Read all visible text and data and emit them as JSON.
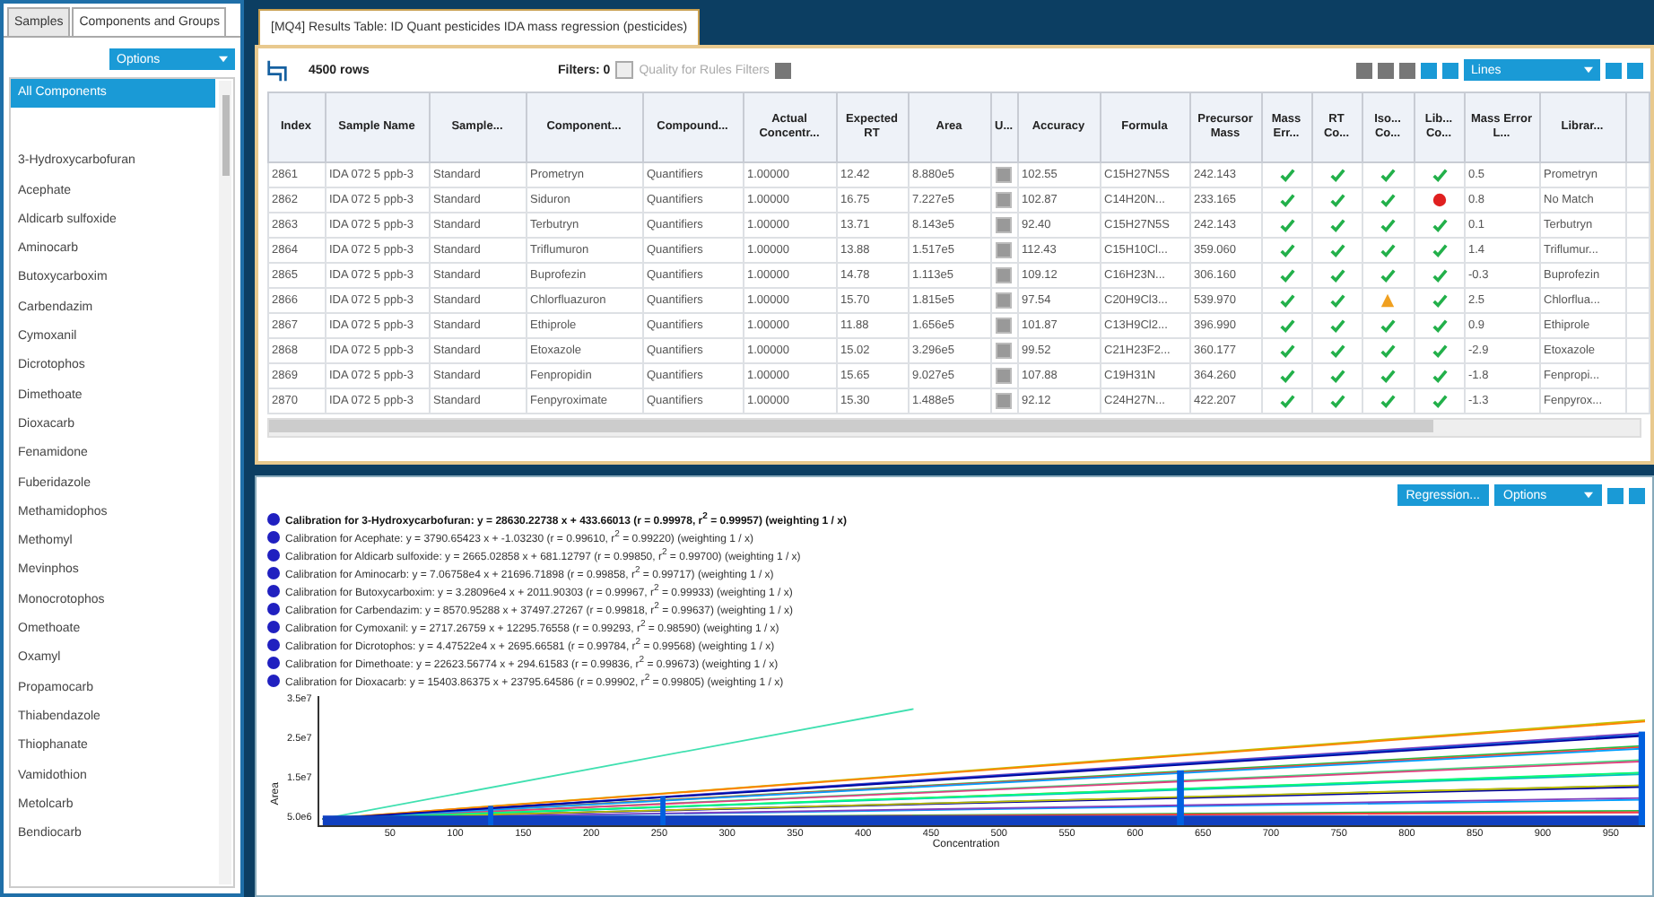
{
  "left_panel": {
    "tabs": [
      {
        "label": "Samples",
        "selected": false
      },
      {
        "label": "Components and Groups",
        "selected": true
      }
    ],
    "options_dropdown": "Options",
    "items": [
      {
        "label": "All Components",
        "selected": true
      },
      {
        "label": "3-Hydroxycarbofuran",
        "selected": false
      },
      {
        "label": "Acephate",
        "selected": false
      },
      {
        "label": "Aldicarb sulfoxide",
        "selected": false
      },
      {
        "label": "Aminocarb",
        "selected": false
      },
      {
        "label": "Butoxycarboxim",
        "selected": false
      },
      {
        "label": "Carbendazim",
        "selected": false
      },
      {
        "label": "Cymoxanil",
        "selected": false
      },
      {
        "label": "Dicrotophos",
        "selected": false
      },
      {
        "label": "Dimethoate",
        "selected": false
      },
      {
        "label": "Dioxacarb",
        "selected": false
      },
      {
        "label": "Fenamidone",
        "selected": false
      },
      {
        "label": "Fuberidazole",
        "selected": false
      },
      {
        "label": "Methamidophos",
        "selected": false
      },
      {
        "label": "Methomyl",
        "selected": false
      },
      {
        "label": "Mevinphos",
        "selected": false
      },
      {
        "label": "Monocrotophos",
        "selected": false
      },
      {
        "label": "Omethoate",
        "selected": false
      },
      {
        "label": "Oxamyl",
        "selected": false
      },
      {
        "label": "Propamocarb",
        "selected": false
      },
      {
        "label": "Thiabendazole",
        "selected": false
      },
      {
        "label": "Thiophanate",
        "selected": false
      },
      {
        "label": "Vamidothion",
        "selected": false
      },
      {
        "label": "Metolcarb",
        "selected": false
      },
      {
        "label": "Bendiocarb",
        "selected": false
      }
    ]
  },
  "document_tab": "[MQ4] Results Table: ID Quant pesticides IDA mass regression (pesticides)",
  "toolbar": {
    "row_count": "4500 rows",
    "filters": "Filters: 0",
    "quality_filter": {
      "label": "Quality for Rules Filters",
      "checked": false
    },
    "view_dropdown": "Lines"
  },
  "table": {
    "columns": [
      "Index",
      "Sample Name",
      "Sample...",
      "Component...",
      "Compound...",
      "Actual Concentr...",
      "Expected RT",
      "Area",
      "U...",
      "Accuracy",
      "Formula",
      "Precursor Mass",
      "Mass Err...",
      "RT Co...",
      "Iso... Co...",
      "Lib... Co...",
      "Mass Error L...",
      "Librar..."
    ],
    "rows": [
      {
        "cells": [
          "2861",
          "IDA 072 5 ppb-3",
          "Standard",
          "Prometryn",
          "Quantifiers",
          "1.00000",
          "12.42",
          "8.880e5",
          "",
          "102.55",
          "C15H27N5S",
          "242.143",
          "",
          "",
          "",
          "",
          "0.5",
          "Prometryn"
        ],
        "used": true,
        "checks": [
          {
            "passed": true,
            "warning": false
          },
          {
            "passed": true,
            "warning": false
          },
          {
            "passed": true,
            "warning": false
          },
          {
            "passed": true,
            "warning": false
          }
        ]
      },
      {
        "cells": [
          "2862",
          "IDA 072 5 ppb-3",
          "Standard",
          "Siduron",
          "Quantifiers",
          "1.00000",
          "16.75",
          "7.227e5",
          "",
          "102.87",
          "C14H20N...",
          "233.165",
          "",
          "",
          "",
          "",
          "0.8",
          "No Match"
        ],
        "used": true,
        "checks": [
          {
            "passed": true,
            "warning": false
          },
          {
            "passed": true,
            "warning": false
          },
          {
            "passed": true,
            "warning": false
          },
          {
            "passed": false,
            "warning": false
          }
        ]
      },
      {
        "cells": [
          "2863",
          "IDA 072 5 ppb-3",
          "Standard",
          "Terbutryn",
          "Quantifiers",
          "1.00000",
          "13.71",
          "8.143e5",
          "",
          "92.40",
          "C15H27N5S",
          "242.143",
          "",
          "",
          "",
          "",
          "0.1",
          "Terbutryn"
        ],
        "used": true,
        "checks": [
          {
            "passed": true,
            "warning": false
          },
          {
            "passed": true,
            "warning": false
          },
          {
            "passed": true,
            "warning": false
          },
          {
            "passed": true,
            "warning": false
          }
        ]
      },
      {
        "cells": [
          "2864",
          "IDA 072 5 ppb-3",
          "Standard",
          "Triflumuron",
          "Quantifiers",
          "1.00000",
          "13.88",
          "1.517e5",
          "",
          "112.43",
          "C15H10Cl...",
          "359.060",
          "",
          "",
          "",
          "",
          "1.4",
          "Triflumur..."
        ],
        "used": true,
        "checks": [
          {
            "passed": true,
            "warning": false
          },
          {
            "passed": true,
            "warning": false
          },
          {
            "passed": true,
            "warning": false
          },
          {
            "passed": true,
            "warning": false
          }
        ]
      },
      {
        "cells": [
          "2865",
          "IDA 072 5 ppb-3",
          "Standard",
          "Buprofezin",
          "Quantifiers",
          "1.00000",
          "14.78",
          "1.113e5",
          "",
          "109.12",
          "C16H23N...",
          "306.160",
          "",
          "",
          "",
          "",
          "-0.3",
          "Buprofezin"
        ],
        "used": true,
        "checks": [
          {
            "passed": true,
            "warning": false
          },
          {
            "passed": true,
            "warning": false
          },
          {
            "passed": true,
            "warning": false
          },
          {
            "passed": true,
            "warning": false
          }
        ]
      },
      {
        "cells": [
          "2866",
          "IDA 072 5 ppb-3",
          "Standard",
          "Chlorfluazuron",
          "Quantifiers",
          "1.00000",
          "15.70",
          "1.815e5",
          "",
          "97.54",
          "C20H9Cl3...",
          "539.970",
          "",
          "",
          "",
          "",
          "2.5",
          "Chlorflua..."
        ],
        "used": true,
        "checks": [
          {
            "passed": true,
            "warning": false
          },
          {
            "passed": true,
            "warning": false
          },
          {
            "passed": false,
            "warning": true
          },
          {
            "passed": true,
            "warning": false
          }
        ]
      },
      {
        "cells": [
          "2867",
          "IDA 072 5 ppb-3",
          "Standard",
          "Ethiprole",
          "Quantifiers",
          "1.00000",
          "11.88",
          "1.656e5",
          "",
          "101.87",
          "C13H9Cl2...",
          "396.990",
          "",
          "",
          "",
          "",
          "0.9",
          "Ethiprole"
        ],
        "used": true,
        "checks": [
          {
            "passed": true,
            "warning": false
          },
          {
            "passed": true,
            "warning": false
          },
          {
            "passed": true,
            "warning": false
          },
          {
            "passed": true,
            "warning": false
          }
        ]
      },
      {
        "cells": [
          "2868",
          "IDA 072 5 ppb-3",
          "Standard",
          "Etoxazole",
          "Quantifiers",
          "1.00000",
          "15.02",
          "3.296e5",
          "",
          "99.52",
          "C21H23F2...",
          "360.177",
          "",
          "",
          "",
          "",
          "-2.9",
          "Etoxazole"
        ],
        "used": true,
        "checks": [
          {
            "passed": true,
            "warning": false
          },
          {
            "passed": true,
            "warning": false
          },
          {
            "passed": true,
            "warning": false
          },
          {
            "passed": true,
            "warning": false
          }
        ]
      },
      {
        "cells": [
          "2869",
          "IDA 072 5 ppb-3",
          "Standard",
          "Fenpropidin",
          "Quantifiers",
          "1.00000",
          "15.65",
          "9.027e5",
          "",
          "107.88",
          "C19H31N",
          "364.260",
          "",
          "",
          "",
          "",
          "-1.8",
          "Fenpropi..."
        ],
        "used": true,
        "checks": [
          {
            "passed": true,
            "warning": false
          },
          {
            "passed": true,
            "warning": false
          },
          {
            "passed": true,
            "warning": false
          },
          {
            "passed": true,
            "warning": false
          }
        ]
      },
      {
        "cells": [
          "2870",
          "IDA 072 5 ppb-3",
          "Standard",
          "Fenpyroximate",
          "Quantifiers",
          "1.00000",
          "15.30",
          "1.488e5",
          "",
          "92.12",
          "C24H27N...",
          "422.207",
          "",
          "",
          "",
          "",
          "-1.3",
          "Fenpyrox..."
        ],
        "used": true,
        "checks": [
          {
            "passed": true,
            "warning": false
          },
          {
            "passed": true,
            "warning": false
          },
          {
            "passed": true,
            "warning": false
          },
          {
            "passed": true,
            "warning": false
          }
        ]
      }
    ]
  },
  "chart_panel": {
    "buttons": [
      "Regression...",
      "Options"
    ],
    "legend": [
      {
        "text": "Calibration for 3-Hydroxycarbofuran: y = 28630.22738 x + 433.66013 (r = 0.99978, r$^{2}$ = 0.99957) (weighting 1 / x)",
        "bold": true
      },
      {
        "text": "Calibration for Acephate: y = 3790.65423 x + -1.03230 (r = 0.99610, r$^{2}$ = 0.99220) (weighting 1 / x)",
        "bold": false
      },
      {
        "text": "Calibration for Aldicarb sulfoxide: y = 2665.02858 x + 681.12797 (r = 0.99850, r$^{2}$ = 0.99700) (weighting 1 / x)",
        "bold": false
      },
      {
        "text": "Calibration for Aminocarb: y = 7.06758e4 x + 21696.71898 (r = 0.99858, r$^{2}$ = 0.99717) (weighting 1 / x)",
        "bold": false
      },
      {
        "text": "Calibration for Butoxycarboxim: y = 3.28096e4 x + 2011.90303 (r = 0.99967, r$^{2}$ = 0.99933) (weighting 1 / x)",
        "bold": false
      },
      {
        "text": "Calibration for Carbendazim: y = 8570.95288 x + 37497.27267 (r = 0.99818, r$^{2}$ = 0.99637) (weighting 1 / x)",
        "bold": false
      },
      {
        "text": "Calibration for Cymoxanil: y = 2717.26759 x + 12295.76558 (r = 0.99293, r$^{2}$ = 0.98590) (weighting 1 / x)",
        "bold": false
      },
      {
        "text": "Calibration for Dicrotophos: y = 4.47522e4 x + 2695.66581 (r = 0.99784, r$^{2}$ = 0.99568) (weighting 1 / x)",
        "bold": false
      },
      {
        "text": "Calibration for Dimethoate: y = 22623.56774 x + 294.61583 (r = 0.99836, r$^{2}$ = 0.99673) (weighting 1 / x)",
        "bold": false
      },
      {
        "text": "Calibration for Dioxacarb: y = 15403.86375 x + 23795.64586 (r = 0.99902, r$^{2}$ = 0.99805) (weighting 1 / x)",
        "bold": false
      }
    ],
    "y_axis": {
      "title": "Area",
      "ticks": [
        "3.5e7",
        "2.5e7",
        "1.5e7",
        "5.0e6"
      ]
    },
    "x_axis": {
      "title": "Concentration",
      "ticks": [
        "50",
        "100",
        "150",
        "200",
        "250",
        "300",
        "350",
        "400",
        "450",
        "500",
        "550",
        "600",
        "650",
        "700",
        "750",
        "800",
        "850",
        "900",
        "950"
      ]
    }
  }
}
